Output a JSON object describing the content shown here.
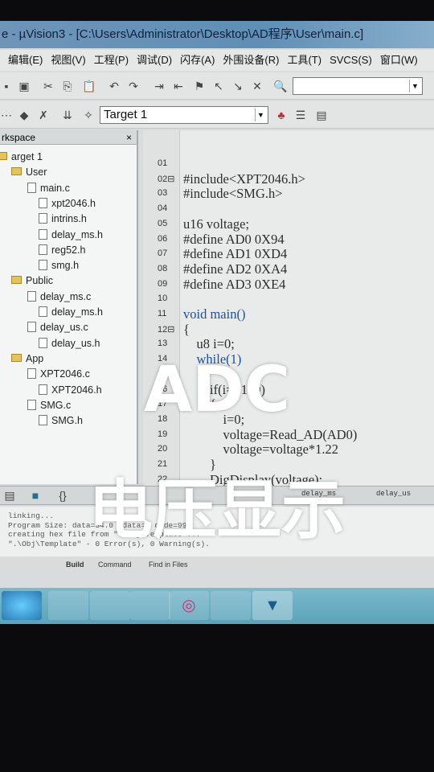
{
  "window": {
    "title": "e - µVision3 - [C:\\Users\\Administrator\\Desktop\\AD程序\\User\\main.c]"
  },
  "menu": [
    "编辑(E)",
    "视图(V)",
    "工程(P)",
    "调试(D)",
    "闪存(A)",
    "外围设备(R)",
    "工具(T)",
    "SVCS(S)",
    "窗口(W)"
  ],
  "toolbar": {
    "target": "Target 1",
    "search_value": ""
  },
  "workspace": {
    "title": "rkspace",
    "close": "× ",
    "items": [
      {
        "label": "arget 1",
        "level": 0,
        "type": "folder"
      },
      {
        "label": "User",
        "level": 1,
        "type": "folder"
      },
      {
        "label": "main.c",
        "level": 2,
        "type": "file"
      },
      {
        "label": "xpt2046.h",
        "level": 3,
        "type": "file"
      },
      {
        "label": "intrins.h",
        "level": 3,
        "type": "file"
      },
      {
        "label": "delay_ms.h",
        "level": 3,
        "type": "file"
      },
      {
        "label": "reg52.h",
        "level": 3,
        "type": "file"
      },
      {
        "label": "smg.h",
        "level": 3,
        "type": "file"
      },
      {
        "label": "Public",
        "level": 1,
        "type": "folder"
      },
      {
        "label": "delay_ms.c",
        "level": 2,
        "type": "file"
      },
      {
        "label": "delay_ms.h",
        "level": 3,
        "type": "file"
      },
      {
        "label": "delay_us.c",
        "level": 2,
        "type": "file"
      },
      {
        "label": "delay_us.h",
        "level": 3,
        "type": "file"
      },
      {
        "label": "App",
        "level": 1,
        "type": "folder"
      },
      {
        "label": "XPT2046.c",
        "level": 2,
        "type": "file"
      },
      {
        "label": "XPT2046.h",
        "level": 3,
        "type": "file"
      },
      {
        "label": "SMG.c",
        "level": 2,
        "type": "file"
      },
      {
        "label": "SMG.h",
        "level": 3,
        "type": "file"
      }
    ]
  },
  "editor": {
    "lines": [
      {
        "n": "01",
        "text": ""
      },
      {
        "n": "02⊟",
        "text": "#include<XPT2046.h>"
      },
      {
        "n": "03",
        "text": "#include<SMG.h>"
      },
      {
        "n": "04",
        "text": ""
      },
      {
        "n": "05",
        "text": "u16 voltage;"
      },
      {
        "n": "06",
        "text": "#define AD0 0X94"
      },
      {
        "n": "07",
        "text": "#define AD1 0XD4"
      },
      {
        "n": "08",
        "text": "#define AD2 0XA4"
      },
      {
        "n": "09",
        "text": "#define AD3 0XE4"
      },
      {
        "n": "10",
        "text": ""
      },
      {
        "n": "11",
        "text": "void main()"
      },
      {
        "n": "12⊟",
        "text": "{"
      },
      {
        "n": "13",
        "text": "    u8 i=0;"
      },
      {
        "n": "14",
        "text": "    while(1)"
      },
      {
        "n": "15",
        "text": "    {"
      },
      {
        "n": "16",
        "text": "        if(i==100)"
      },
      {
        "n": "17",
        "text": "        {"
      },
      {
        "n": "18",
        "text": "            i=0;"
      },
      {
        "n": "19",
        "text": "            voltage=Read_AD(AD0)"
      },
      {
        "n": "20",
        "text": "            voltage=voltage*1.22"
      },
      {
        "n": "21",
        "text": "        }"
      },
      {
        "n": "22",
        "text": "        DigDisplay(voltage);"
      }
    ]
  },
  "filetabs": [
    "delay_ms",
    "delay_us"
  ],
  "output": {
    "lines": [
      "linking...",
      "Program Size: data=34.0 xdata=0 code=994",
      "creating hex file from \".\\Obj\\Template\"...",
      "\".\\Obj\\Template\" - 0 Error(s), 0 Warning(s)."
    ],
    "tabs": [
      "Build",
      "Command",
      "Find in Files"
    ]
  },
  "overlay": {
    "line1": "ADC",
    "line2": "电压显示"
  },
  "colors": {
    "keyword": "#1d4f9a",
    "titlebar": "#6d95b8",
    "taskbar": "#6aaec2"
  }
}
